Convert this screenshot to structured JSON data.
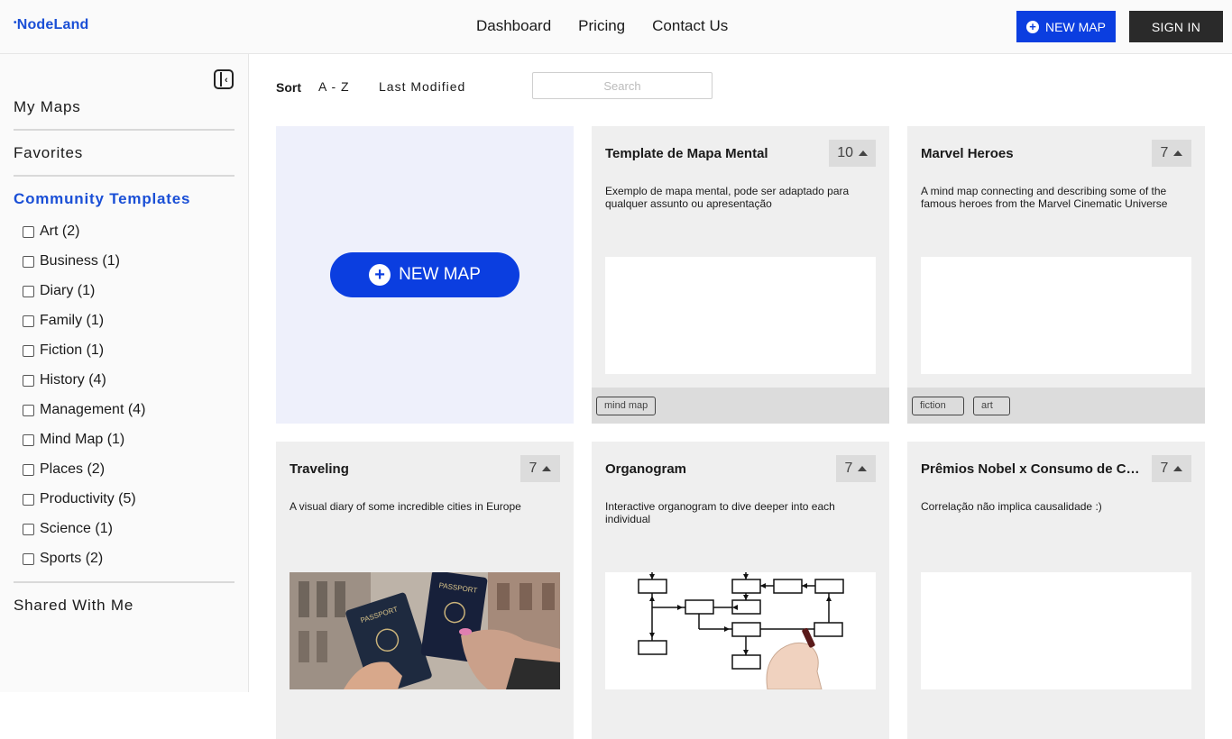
{
  "header": {
    "logo_dot": "•",
    "logo_a": "Node",
    "logo_b": "Land",
    "nav": [
      "Dashboard",
      "Pricing",
      "Contact Us"
    ],
    "new_map_label": "NEW MAP",
    "sign_in_label": "SIGN IN"
  },
  "sidebar": {
    "my_maps": "My Maps",
    "favorites": "Favorites",
    "community_templates": "Community Templates",
    "categories": [
      "Art (2)",
      "Business (1)",
      "Diary (1)",
      "Family (1)",
      "Fiction (1)",
      "History (4)",
      "Management (4)",
      "Mind Map (1)",
      "Places (2)",
      "Productivity (5)",
      "Science (1)",
      "Sports (2)"
    ],
    "shared_with_me": "Shared With Me"
  },
  "toolbar": {
    "sort_label": "Sort",
    "sort_az": "A - Z",
    "sort_modified": "Last Modified",
    "search_placeholder": "Search"
  },
  "new_map_card": {
    "label": "NEW MAP"
  },
  "cards": [
    {
      "title": "Template de Mapa Mental",
      "votes": "10",
      "description": "Exemplo de mapa mental, pode ser adaptado para qualquer assunto ou apresentação",
      "tags": [
        "mind map"
      ],
      "preview": "blank"
    },
    {
      "title": "Marvel Heroes",
      "votes": "7",
      "description": "A mind map connecting and describing some of the famous heroes from the Marvel Cinematic Universe",
      "tags": [
        "fiction",
        "art"
      ],
      "preview": "blank"
    },
    {
      "title": "Traveling",
      "votes": "7",
      "description": "A visual diary of some incredible cities in Europe",
      "tags": [],
      "preview": "passport-photo",
      "photo_text": [
        "PASSPORT",
        "PASSPORT"
      ]
    },
    {
      "title": "Organogram",
      "votes": "7",
      "description": "Interactive organogram to dive deeper into each individual",
      "tags": [],
      "preview": "organogram-diagram"
    },
    {
      "title": "Prêmios Nobel x Consumo de Chocolate",
      "votes": "7",
      "description": "Correlação não implica causalidade :)",
      "tags": [],
      "preview": "blank"
    }
  ],
  "colors": {
    "accent": "#0b3ee0",
    "logo": "#1a4fd6",
    "new_card_bg": "#eef0fb",
    "card_bg": "#efefef"
  }
}
